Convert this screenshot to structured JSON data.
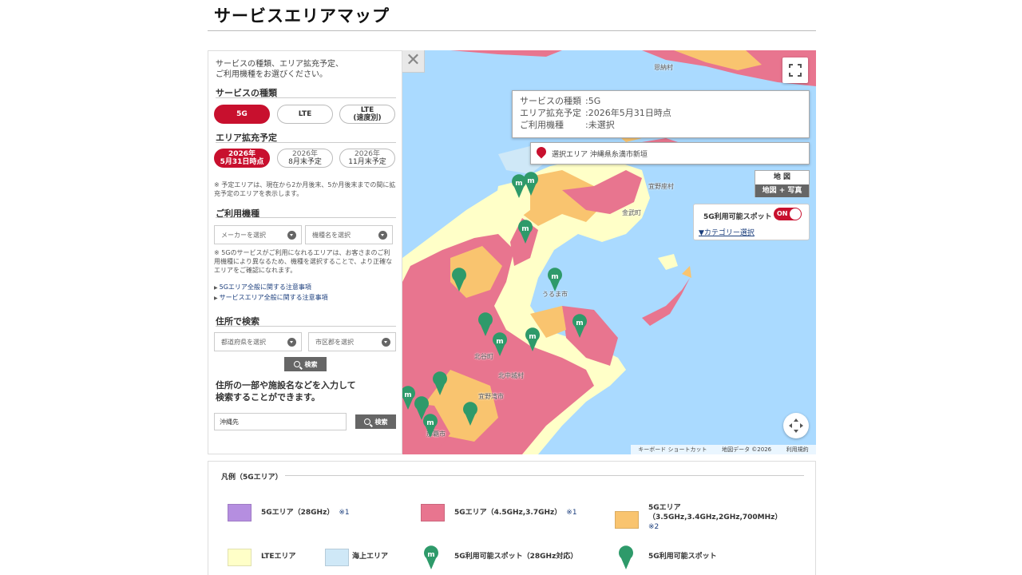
{
  "page": {
    "title": "サービスエリアマップ"
  },
  "panel": {
    "intro_lines": [
      "サービスの種類、エリア拡充予定、",
      "ご利用機種をお選びください。"
    ],
    "service_title": "サービスの種類",
    "service_buttons": [
      {
        "label": "5G"
      },
      {
        "label": "LTE"
      },
      {
        "label_line1": "LTE",
        "label_line2": "(速度別)"
      }
    ],
    "expansion_title": "エリア拡充予定",
    "expansion_buttons": [
      {
        "line1": "2026年",
        "line2": "5月31日時点"
      },
      {
        "line1": "2026年",
        "line2": "8月末予定"
      },
      {
        "line1": "2026年",
        "line2": "11月末予定"
      }
    ],
    "expansion_note": "※ 予定エリアは、現在から2か月後末、5か月後末までの間に拡充予定のエリアを表示します。",
    "device_title": "ご利用機種",
    "maker_placeholder": "メーカーを選択",
    "model_placeholder": "機種名を選択",
    "device_note": "※ 5Gのサービスがご利用になれるエリアは、お客さまのご利用機種により異なるため、機種を選択することで、より正確なエリアをご確認になれます。",
    "links": [
      "5Gエリア全般に関する注意事項",
      "サービスエリア全般に関する注意事項"
    ],
    "address_title": "住所で検索",
    "pref_placeholder": "都道府県を選択",
    "city_placeholder": "市区郡を選択",
    "search_label": "検索",
    "free_text_lines": [
      "住所の一部や施設名などを入力して",
      "検索することができます。"
    ],
    "free_text_value": "沖縄先",
    "search_label2": "検索"
  },
  "map": {
    "info": [
      {
        "k": "サービスの種類",
        "v": ":5G"
      },
      {
        "k": "エリア拡充予定",
        "v": ":2026年5月31日時点"
      },
      {
        "k": "ご利用機種",
        "v": ":未選択"
      }
    ],
    "selected_area": "選択エリア  沖縄県糸満市新垣",
    "maptype": {
      "map": "地 図",
      "satellite": "地図 + 写真"
    },
    "spot_toggle": {
      "label": "5G利用可能スポット",
      "state": "ON"
    },
    "category_link": "▼カテゴリー選択",
    "attribution": [
      "キーボード ショートカット",
      "地図データ ©2026",
      "利用規約"
    ],
    "places": [
      "恩納村",
      "宜野座村",
      "うるま市",
      "北谷町",
      "北中城村",
      "宜野湾市",
      "那覇市",
      "金武町"
    ]
  },
  "legend": {
    "title": "凡例（5Gエリア）",
    "items": [
      {
        "label": "5Gエリア（28GHz）",
        "note": "※1",
        "color": "#b58ee0"
      },
      {
        "label": "5Gエリア（4.5GHz,3.7GHz）",
        "note": "※1",
        "color": "#e8758f"
      },
      {
        "label_line1": "5Gエリア",
        "label_line2": "（3.5GHz,3.4GHz,2GHz,700MHz）",
        "note": "※2",
        "color": "#f9c46f"
      },
      {
        "label": "LTEエリア",
        "color": "#ffffc8"
      },
      {
        "label": "海上エリア",
        "color": "#cfe8f7"
      },
      {
        "label": "5G利用可能スポット（28GHz対応）"
      },
      {
        "label": "5G利用可能スポット"
      }
    ]
  },
  "colors": {
    "accent": "#c8102e",
    "pin": "#2e9a6a",
    "area_5g_mid": "#e8758f",
    "area_5g_low": "#f9c46f",
    "lte": "#ffffc8",
    "sea": "#aadaff"
  }
}
